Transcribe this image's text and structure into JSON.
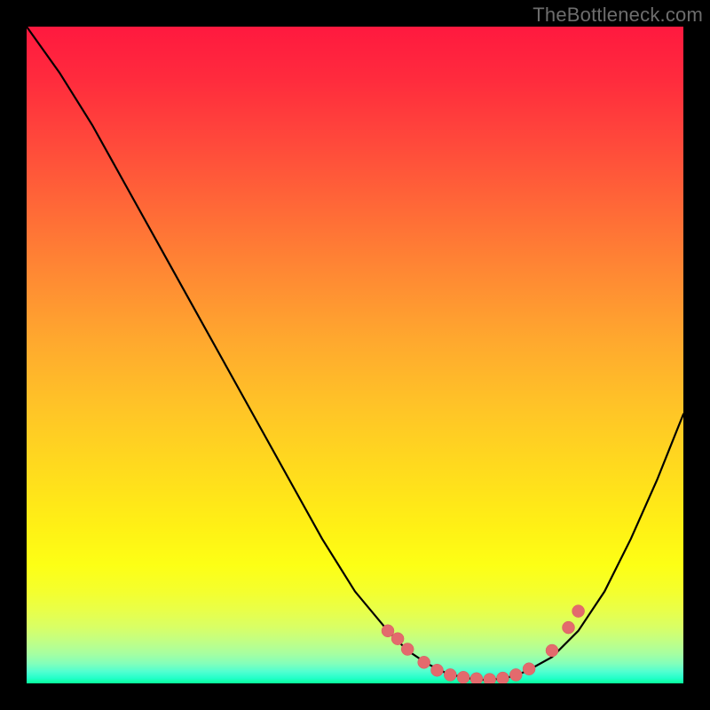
{
  "watermark": "TheBottleneck.com",
  "colors": {
    "background": "#000000",
    "curve": "#000000",
    "dots": "#e36a6d"
  },
  "chart_data": {
    "type": "line",
    "title": "",
    "xlabel": "",
    "ylabel": "",
    "x": [
      0.0,
      0.05,
      0.1,
      0.15,
      0.2,
      0.25,
      0.3,
      0.35,
      0.4,
      0.45,
      0.5,
      0.55,
      0.58,
      0.61,
      0.64,
      0.67,
      0.7,
      0.73,
      0.76,
      0.8,
      0.84,
      0.88,
      0.92,
      0.96,
      1.0
    ],
    "values": [
      100,
      93,
      85,
      76,
      67,
      58,
      49,
      40,
      31,
      22,
      14,
      8,
      5,
      3,
      1.5,
      0.8,
      0.5,
      0.8,
      1.8,
      4,
      8,
      14,
      22,
      31,
      41
    ],
    "ylim": [
      0,
      100
    ],
    "xlim": [
      0,
      1
    ],
    "dot_points": [
      {
        "x": 0.55,
        "y": 8
      },
      {
        "x": 0.565,
        "y": 6.8
      },
      {
        "x": 0.58,
        "y": 5.2
      },
      {
        "x": 0.605,
        "y": 3.2
      },
      {
        "x": 0.625,
        "y": 2.0
      },
      {
        "x": 0.645,
        "y": 1.3
      },
      {
        "x": 0.665,
        "y": 0.9
      },
      {
        "x": 0.685,
        "y": 0.7
      },
      {
        "x": 0.705,
        "y": 0.6
      },
      {
        "x": 0.725,
        "y": 0.8
      },
      {
        "x": 0.745,
        "y": 1.3
      },
      {
        "x": 0.765,
        "y": 2.2
      },
      {
        "x": 0.8,
        "y": 5.0
      },
      {
        "x": 0.825,
        "y": 8.5
      },
      {
        "x": 0.84,
        "y": 11.0
      }
    ],
    "annotations": []
  }
}
